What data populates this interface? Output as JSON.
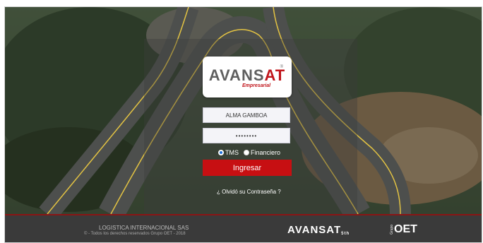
{
  "logo": {
    "brand_main": "AVANS",
    "brand_accent": "AT",
    "registered": "®",
    "subtitle": "Empresarial"
  },
  "form": {
    "username_value": "ALMA GAMBOA",
    "password_value": "••••••••",
    "radio_tms": "TMS",
    "radio_financiero": "Financiero",
    "selected": "TMS",
    "login_button": "Ingresar",
    "forgot_link": "¿ Olvidó su Contraseña ?"
  },
  "footer": {
    "company": "LOGISTICA INTERNACIONAL SAS",
    "copyright": "© - Todos los derechos reservados Grupo OET - 2018",
    "brand": "AVANSAT",
    "brand_tag": "5th",
    "group_small": "Grupo",
    "group_logo": "OET"
  },
  "colors": {
    "accent_red": "#c70f12",
    "footer_bg": "#3a3a3a",
    "radio_selected": "#1e6fd9"
  }
}
